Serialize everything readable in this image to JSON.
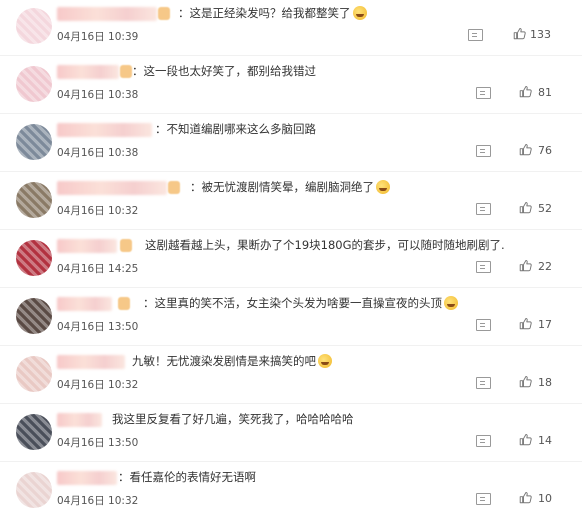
{
  "comments": [
    {
      "text": "：这是正经染发吗？给我都整笑了",
      "emoji": true,
      "time": "04月16日 10:39",
      "likes": "133",
      "avatar_color": "#f4d7dd"
    },
    {
      "text": "：这一段也太好笑了，都别给我错过",
      "emoji": false,
      "time": "04月16日 10:38",
      "likes": "81",
      "avatar_color": "#f0c8d0"
    },
    {
      "text": "：不知道编剧哪来这么多脑回路",
      "emoji": false,
      "time": "04月16日 10:38",
      "likes": "76",
      "avatar_color": "#7d8a9a"
    },
    {
      "text": "：被无忧渡剧情笑晕，编剧脑洞绝了",
      "emoji": true,
      "time": "04月16日 10:32",
      "likes": "52",
      "avatar_color": "#8a7a66"
    },
    {
      "text": "这剧越看越上头，果断办了个19块180G的套步，可以随时随地刷剧了.",
      "emoji": false,
      "time": "04月16日 14:25",
      "likes": "22",
      "avatar_color": "#b23240"
    },
    {
      "text": "：这里真的笑不活，女主染个头发为啥要一直操宣夜的头顶",
      "emoji": true,
      "time": "04月16日 13:50",
      "likes": "17",
      "avatar_color": "#5a4a44"
    },
    {
      "text": "九敏！无忧渡染发剧情是来搞笑的吧",
      "emoji": true,
      "time": "04月16日 10:32",
      "likes": "18",
      "avatar_color": "#e9c9c4"
    },
    {
      "text": "我这里反复看了好几遍，笑死我了，哈哈哈哈哈",
      "emoji": false,
      "time": "04月16日 13:50",
      "likes": "14",
      "avatar_color": "#4a4f5a"
    },
    {
      "text": "：看任嘉伦的表情好无语啊",
      "emoji": false,
      "time": "04月16日 10:32",
      "likes": "10",
      "avatar_color": "#ead4d2"
    }
  ],
  "icons": {
    "reply": "comment-icon",
    "like": "thumbs-up-icon"
  }
}
